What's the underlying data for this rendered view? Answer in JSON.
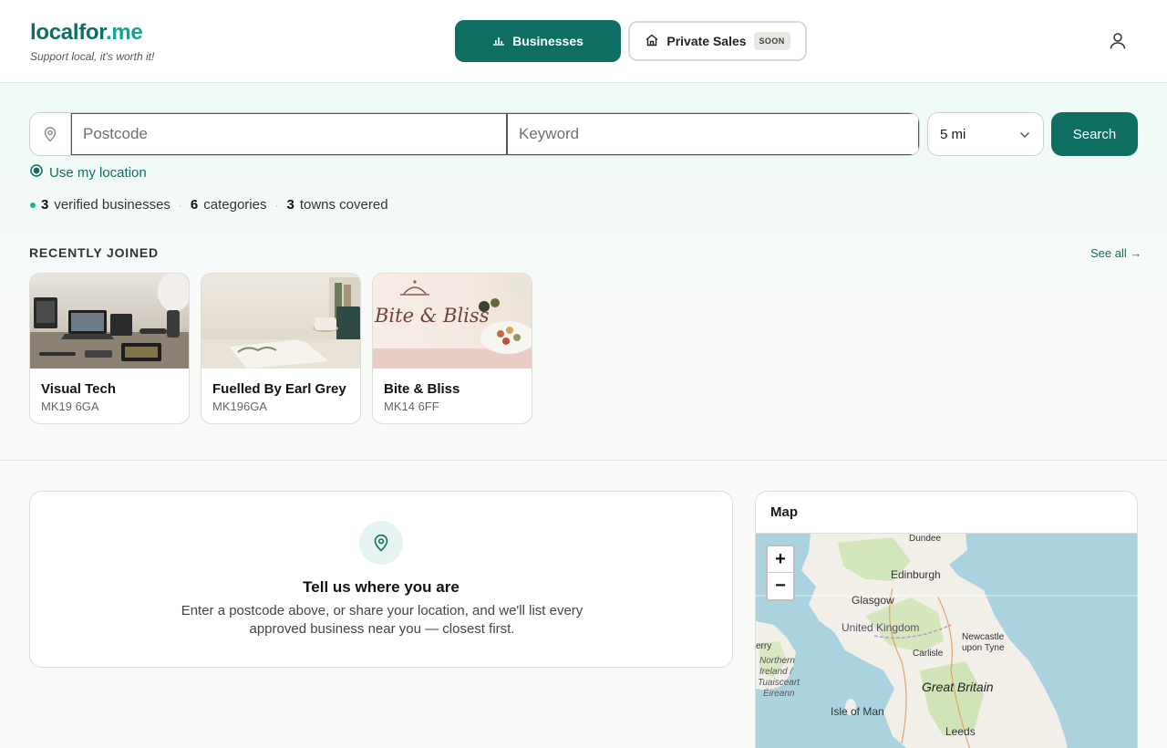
{
  "header": {
    "logo_main": "localfor",
    "logo_tld": ".me",
    "tagline": "Support local, it's worth it!",
    "nav": {
      "businesses_label": "Businesses",
      "private_sales_label": "Private Sales",
      "soon_badge": "SOON"
    },
    "user_icon": "user-icon"
  },
  "search": {
    "postcode_placeholder": "Postcode",
    "postcode_value": "",
    "keyword_placeholder": "Keyword",
    "keyword_value": "",
    "radius_value": "5 mi",
    "search_label": "Search",
    "use_location_label": "Use my location"
  },
  "stats": {
    "businesses_count": "3",
    "businesses_label": "verified businesses",
    "categories_count": "6",
    "categories_label": "categories",
    "towns_count": "3",
    "towns_label": "towns covered"
  },
  "recent": {
    "title": "RECENTLY JOINED",
    "see_all": "See all →",
    "items": [
      {
        "name": "Visual Tech",
        "postcode": "MK19 6GA"
      },
      {
        "name": "Fuelled By Earl Grey",
        "postcode": "MK196GA"
      },
      {
        "name": "Bite & Bliss",
        "postcode": "MK14 6FF",
        "image_text": "Bite & Bliss"
      }
    ]
  },
  "empty_state": {
    "heading": "Tell us where you are",
    "description": "Enter a postcode above, or share your location, and we'll list every approved business near you — closest first."
  },
  "map": {
    "title": "Map",
    "zoom_in": "+",
    "zoom_out": "−",
    "labels": {
      "dundee": "Dundee",
      "edinburgh": "Edinburgh",
      "glasgow": "Glasgow",
      "uk": "United Kingdom",
      "newcastle_1": "Newcastle",
      "newcastle_2": "upon Tyne",
      "carlisle": "Carlisle",
      "ni_1": "Northern",
      "ni_2": "Ireland /",
      "ni_3": "Tuaisceart",
      "ni_4": "Éireann",
      "great_britain": "Great Britain",
      "isle_of_man": "Isle of Man",
      "leeds": "Leeds",
      "erry": "erry"
    }
  },
  "colors": {
    "brand": "#0f6e62",
    "brand_light": "#15a58c",
    "sea": "#aad3df",
    "land": "#f2efe9"
  }
}
